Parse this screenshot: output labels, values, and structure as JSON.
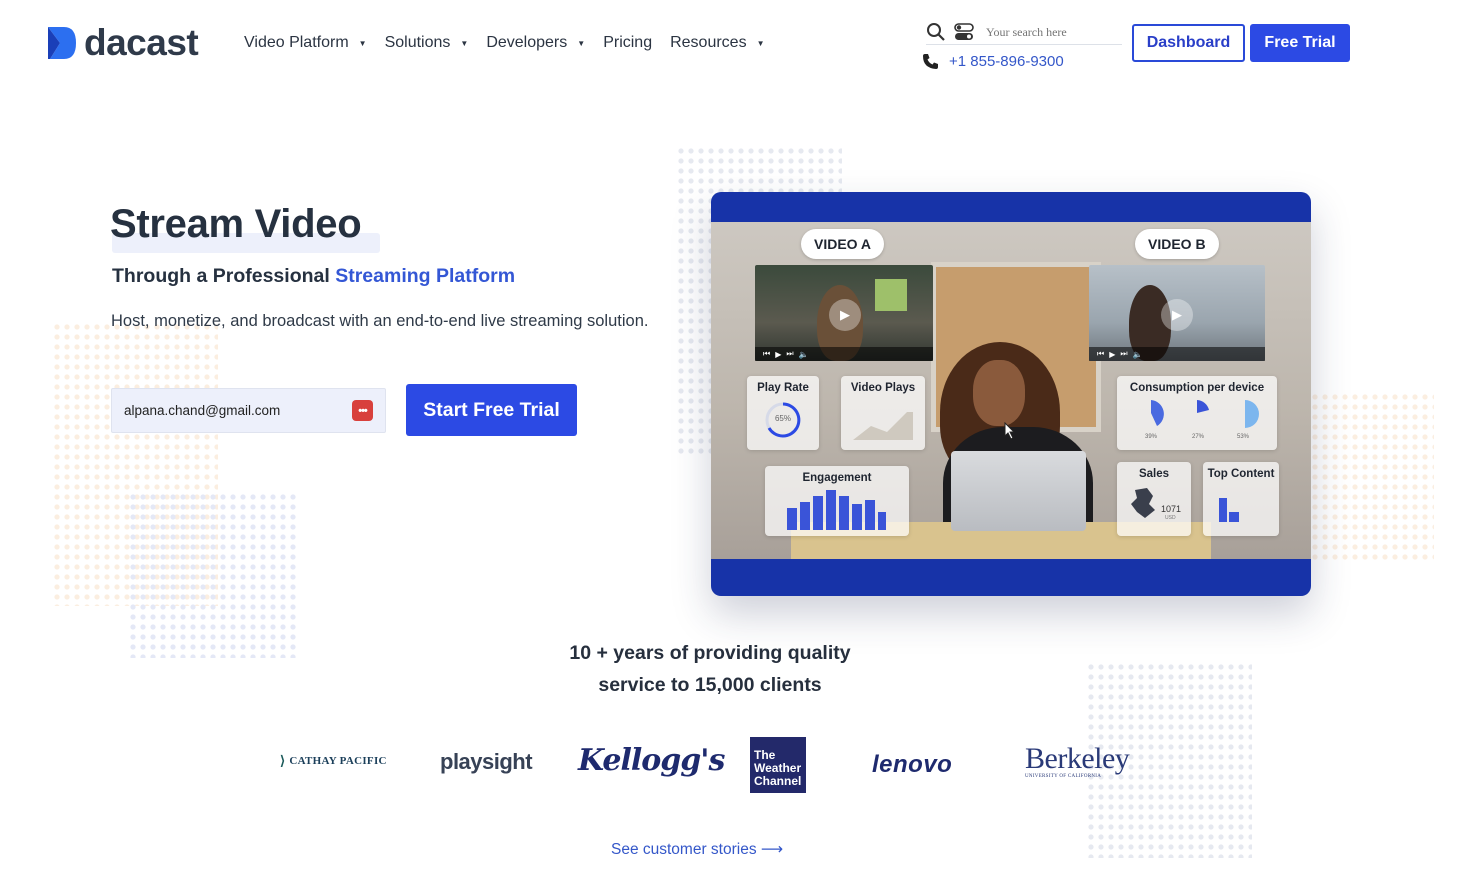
{
  "header": {
    "logo_text": "dacast",
    "nav": [
      {
        "label": "Video Platform",
        "has_dropdown": true
      },
      {
        "label": "Solutions",
        "has_dropdown": true
      },
      {
        "label": "Developers",
        "has_dropdown": true
      },
      {
        "label": "Pricing",
        "has_dropdown": false
      },
      {
        "label": "Resources",
        "has_dropdown": true
      }
    ],
    "search_placeholder": "Your search here",
    "phone": "+1 855-896-9300",
    "dashboard_label": "Dashboard",
    "free_trial_label": "Free Trial",
    "icons": [
      "search-icon",
      "toggle-icon",
      "phone-icon"
    ]
  },
  "hero": {
    "title": "Stream Video",
    "subtitle_plain": "Through a Professional ",
    "subtitle_accent": "Streaming Platform",
    "description": "Host, monetize, and broadcast with an end-to-end live streaming solution.",
    "email_value": "alpana.chand@gmail.com",
    "cta_label": "Start Free Trial"
  },
  "video": {
    "label_a": "VIDEO A",
    "label_b": "VIDEO B",
    "widgets": {
      "play_rate": "Play Rate",
      "play_rate_value": "65%",
      "video_plays": "Video Plays",
      "consumption": "Consumption per device",
      "consumption_values": [
        "39%",
        "27%",
        "53%"
      ],
      "engagement": "Engagement",
      "sales": "Sales",
      "sales_value": "1071",
      "sales_unit": "USD",
      "top_content": "Top Content"
    }
  },
  "clients": {
    "line1": "10 + years of providing quality",
    "line2": "service to 15,000 clients",
    "logos": {
      "cathay": "CATHAY PACIFIC",
      "playsight": "playsight",
      "kelloggs": "Kellogg's",
      "weather_1": "The",
      "weather_2": "Weather",
      "weather_3": "Channel",
      "lenovo": "lenovo",
      "berkeley": "Berkeley",
      "berkeley_sub": "UNIVERSITY OF CALIFORNIA"
    },
    "see_stories": "See customer stories ⟶"
  },
  "colors": {
    "brand_blue": "#2c4ae4",
    "accent_text": "#3457d5",
    "video_frame": "#1733a8"
  }
}
